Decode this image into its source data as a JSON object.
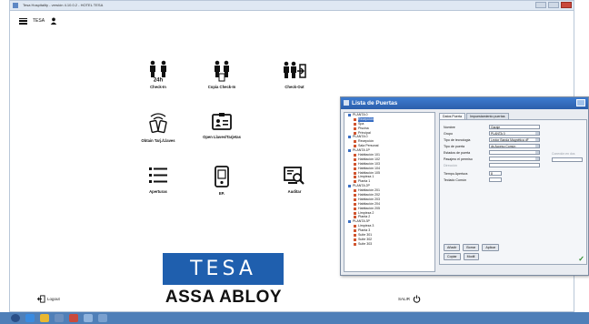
{
  "window": {
    "title": "Tesa Hospitality - versión 4.10.0.2 - HOTEL TESA"
  },
  "topbar": {
    "user_code": "TESA"
  },
  "tiles": [
    {
      "id": "checkin",
      "label": "Check-In"
    },
    {
      "id": "copy",
      "label": "Copia Check-In"
    },
    {
      "id": "checkout",
      "label": "Check-Out"
    },
    {
      "id": "readcards",
      "label": "Obtain Tarj./Llaves"
    },
    {
      "id": "openkeys",
      "label": "Open Llaves/Tarjetas"
    },
    {
      "id": "apertures",
      "label": "Aperturas"
    },
    {
      "id": "ep",
      "label": "EP."
    },
    {
      "id": "auditor",
      "label": "Auditar"
    }
  ],
  "brand": {
    "tesa": "TESA",
    "assa": "ASSA ABLOY",
    "accent": "#1f5fae"
  },
  "footer": {
    "logout": "Logout",
    "exit": "SALIR"
  },
  "dialog": {
    "title": "Lista de Puertas",
    "tree": [
      "PLANTA 0",
      "Recepción",
      "Spa",
      "Piscina",
      "Principal",
      "PLANTA 0",
      "Recepción",
      "Sala Personal",
      "PLANTA 1P",
      "Habitación 101",
      "Habitación 102",
      "Habitación 103",
      "Habitación 104",
      "Habitación 105",
      "Limpieza 1",
      "Planta 1",
      "PLANTA 2P",
      "Habitación 201",
      "Habitación 202",
      "Habitación 203",
      "Habitación 204",
      "Habitación 205",
      "Limpieza 2",
      "Planta 2",
      "PLANTA 3P",
      "Limpieza 3",
      "Planta 3",
      "Suite 301",
      "Suite 302",
      "Suite 303"
    ],
    "tabs": [
      "Datos Puerta",
      "Impuestamiento puertas"
    ],
    "fields": [
      {
        "label": "Nombre",
        "value": "Garaje"
      },
      {
        "label": "Grupo",
        "value": "PLANTA 0"
      },
      {
        "label": "Tipo de tecnología",
        "value": "Lector Banda Magnética dF"
      },
      {
        "label": "Tipo de puerta",
        "value": "ds Acceso Común"
      },
      {
        "label": "Estados de puerta",
        "value": ""
      },
      {
        "label": "Pasajero el permiso",
        "value": ""
      },
      {
        "label": "Dirección",
        "value": ""
      },
      {
        "label": "Tiempo Apertura",
        "value": "8"
      },
      {
        "label": "Teclado Común",
        "value": ""
      }
    ],
    "side_label": "Conexión en dos",
    "buttons_row1": [
      "Añadir",
      "Borrar",
      "Aplicar"
    ],
    "buttons_row2": [
      "Copiar",
      "Modif."
    ]
  }
}
